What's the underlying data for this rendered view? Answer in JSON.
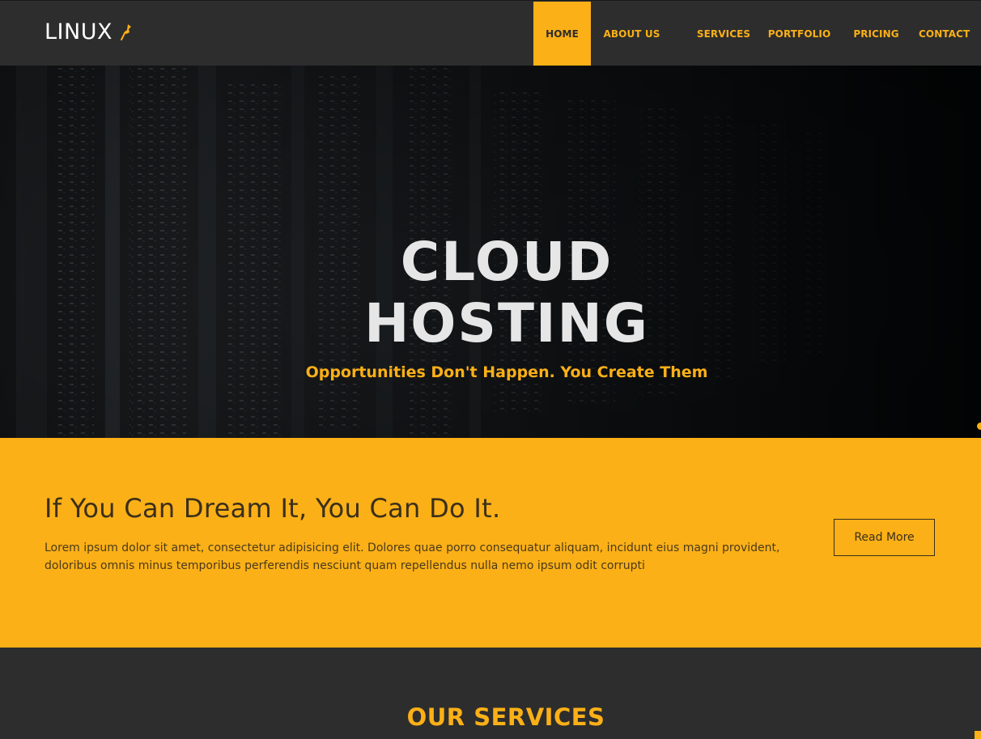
{
  "brand": {
    "name": "LINUX",
    "icon": "pin-icon"
  },
  "nav": {
    "items": [
      {
        "label": "HOME",
        "active": true
      },
      {
        "label": "ABOUT US",
        "active": false
      },
      {
        "label": "SERVICES",
        "active": false
      },
      {
        "label": "PORTFOLIO",
        "active": false
      },
      {
        "label": "PRICING",
        "active": false
      },
      {
        "label": "CONTACT",
        "active": false
      }
    ]
  },
  "hero": {
    "title_line1": "CLOUD",
    "title_line2": "HOSTING",
    "subtitle": "Opportunities Don't Happen. You Create Them"
  },
  "cta": {
    "title": "If You Can Dream It, You Can Do It.",
    "text": "Lorem ipsum dolor sit amet, consectetur adipisicing elit. Dolores quae porro consequatur aliquam, incidunt eius magni provident, doloribus omnis minus temporibus perferendis nesciunt quam repellendus nulla nemo ipsum odit corrupti",
    "button_label": "Read More"
  },
  "services": {
    "title": "OUR SERVICES"
  },
  "colors": {
    "accent": "#fbb017",
    "dark": "#2d2d2d",
    "text_dark": "#3a2f1b"
  }
}
